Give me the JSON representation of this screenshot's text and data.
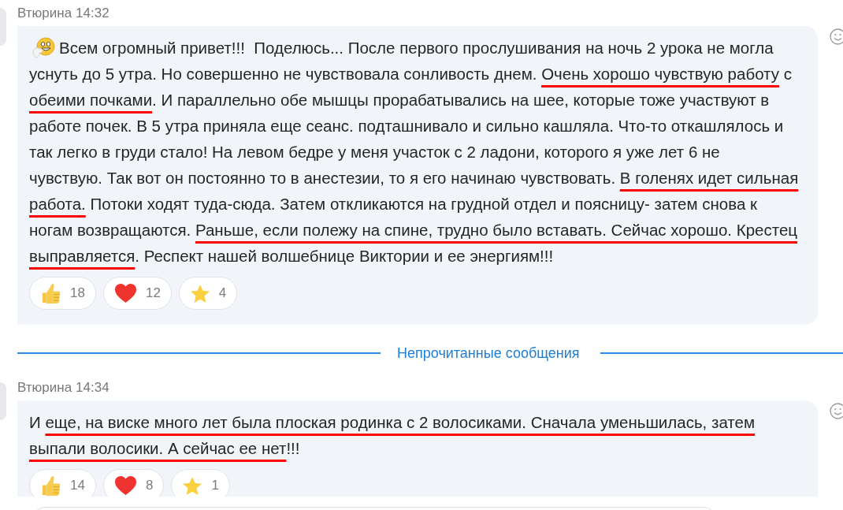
{
  "feed": [
    {
      "kind": "message",
      "sender": "Втюрина",
      "time": "14:32",
      "emoji": true,
      "lines": [
        [
          {
            "kind": "plain",
            "text": "Всем огромный привет!!!  Поделюсь... После первого прослушивания на ночь 2 урока не могла"
          }
        ],
        [
          {
            "kind": "plain",
            "text": "уснуть до 5 утра. Но совершенно не чувствовала сонливость днем. "
          },
          {
            "kind": "underlined",
            "text": "Очень хорошо чувствую работу"
          },
          {
            "kind": "plain",
            "text": " с"
          }
        ],
        [
          {
            "kind": "underlined",
            "text": "обеими почками"
          },
          {
            "kind": "plain",
            "text": ". И параллельно обе мышцы прорабатывались на шее, которые тоже участвуют в"
          }
        ],
        [
          {
            "kind": "plain",
            "text": "работе почек. В 5 утра приняла еще сеанс. подташнивало и сильно кашляла. Что-то откашлялось и"
          }
        ],
        [
          {
            "kind": "plain",
            "text": "так легко в груди стало! На левом бедре у меня участок с 2 ладони, которого я уже лет 6 не"
          }
        ],
        [
          {
            "kind": "plain",
            "text": "чувствую. Так вот он постоянно то в анестезии, то я его начинаю чувствовать. "
          },
          {
            "kind": "underlined",
            "text": "В голенях идет сильная"
          }
        ],
        [
          {
            "kind": "underlined",
            "text": "работа."
          },
          {
            "kind": "plain",
            "text": " Потоки ходят туда-сюда. Затем откликаются на грудной отдел и поясницу- затем снова к"
          }
        ],
        [
          {
            "kind": "plain",
            "text": "ногам возвращаются. "
          },
          {
            "kind": "underlined",
            "text": "Раньше, если полежу на спине, трудно было вставать. Сейчас хорошо. Крестец"
          }
        ],
        [
          {
            "kind": "underlined",
            "text": "выправляется"
          },
          {
            "kind": "plain",
            "text": ". Респект нашей волшебнице Виктории и ее энергиям!!!"
          }
        ]
      ],
      "reactions": [
        {
          "kind": "like",
          "count": "18"
        },
        {
          "kind": "heart",
          "count": "12"
        },
        {
          "kind": "star",
          "count": "4"
        }
      ]
    },
    {
      "kind": "divider",
      "label": "Непрочитанные сообщения"
    },
    {
      "kind": "message",
      "sender": "Втюрина",
      "time": "14:34",
      "emoji": false,
      "lines": [
        [
          {
            "kind": "plain",
            "text": "И "
          },
          {
            "kind": "underlined",
            "text": "еще, на виске много лет была плоская родинка с 2 волосиками. Сначала уменьшилась, затем"
          }
        ],
        [
          {
            "kind": "underlined",
            "text": "выпали волосики. А сейчас ее нет"
          },
          {
            "kind": "plain",
            "text": "!!!"
          }
        ]
      ],
      "reactions": [
        {
          "kind": "like",
          "count": "14"
        },
        {
          "kind": "heart",
          "count": "8"
        },
        {
          "kind": "star",
          "count": "1"
        }
      ]
    }
  ]
}
